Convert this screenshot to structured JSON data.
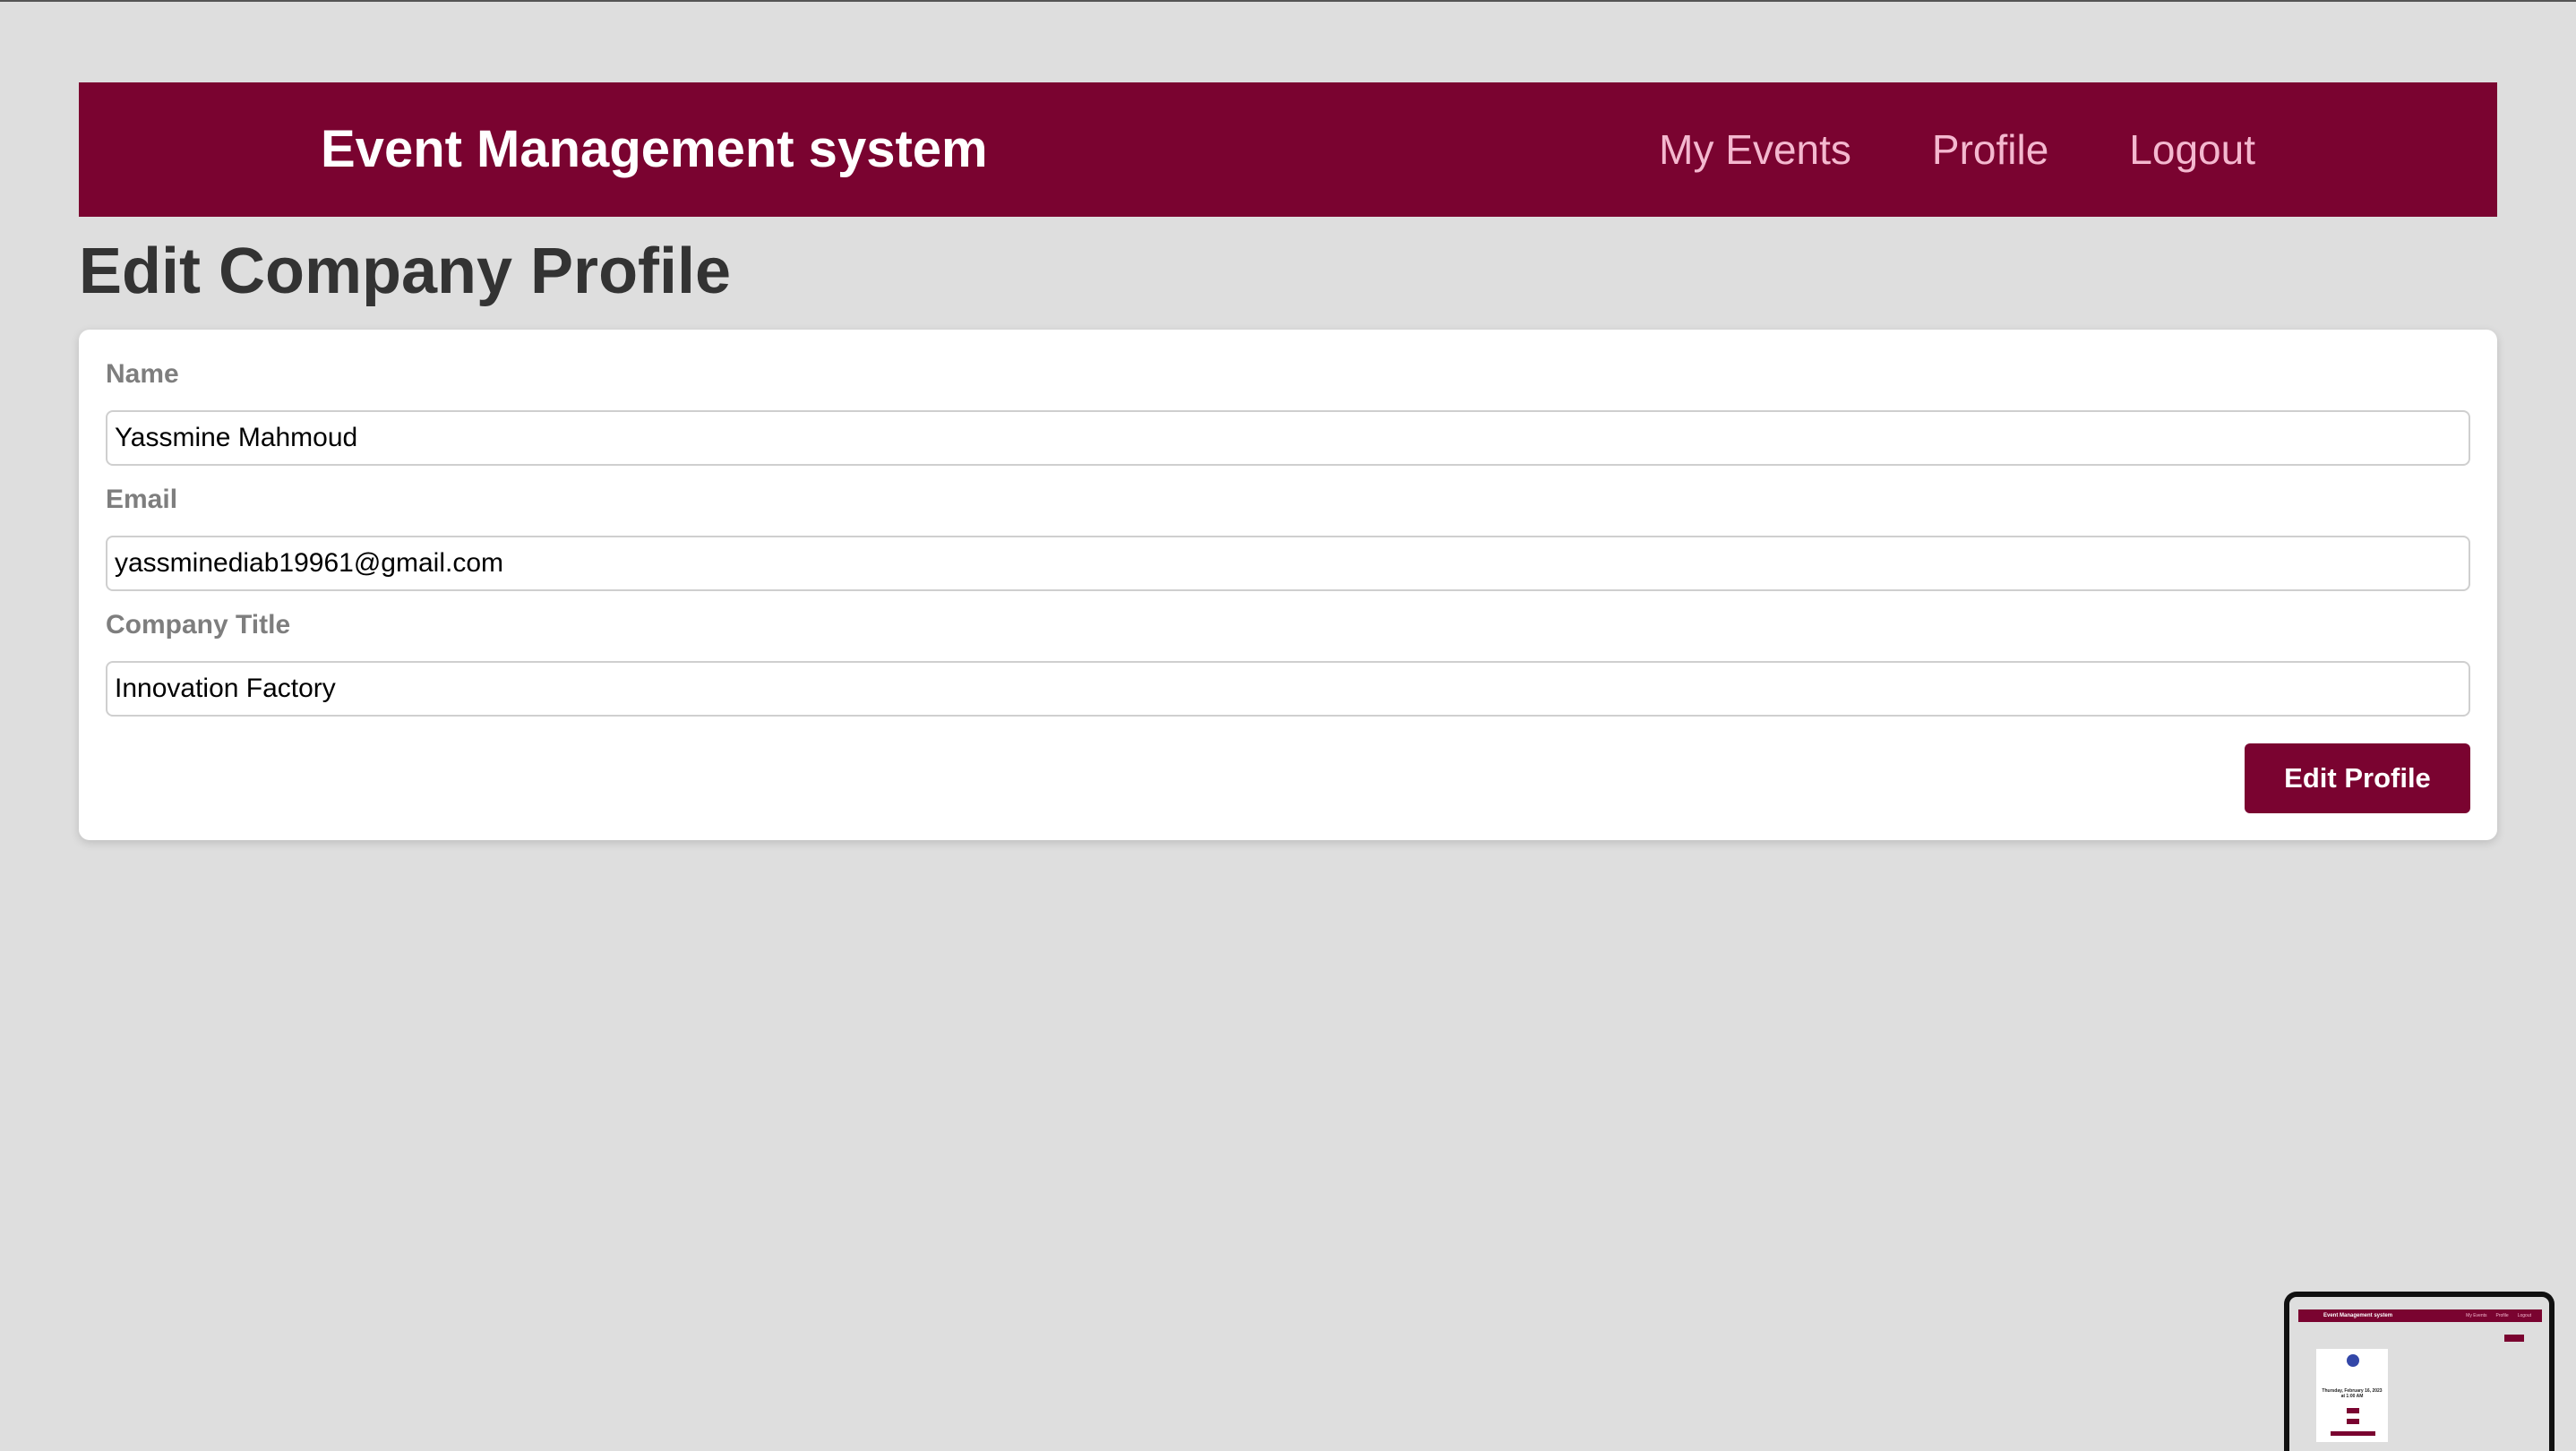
{
  "app": {
    "brand": "Event Management system"
  },
  "nav": {
    "links": [
      {
        "label": "My Events"
      },
      {
        "label": "Profile"
      },
      {
        "label": "Logout"
      }
    ]
  },
  "page": {
    "title": "Edit Company Profile"
  },
  "form": {
    "fields": [
      {
        "label": "Name",
        "value": "Yassmine Mahmoud"
      },
      {
        "label": "Email",
        "value": "yassminediab19961@gmail.com"
      },
      {
        "label": "Company Title",
        "value": "Innovation Factory"
      }
    ],
    "submit_label": "Edit Profile"
  },
  "colors": {
    "brand": "#7a0330",
    "background": "#dedede",
    "nav_link": "#f4b8cf",
    "card": "#ffffff"
  },
  "thumbnail": {
    "brand": "Event Management system",
    "links": [
      "My Events",
      "Profile",
      "Logout"
    ],
    "date_text": "Thursday, February 16, 2023 at 1:00 AM"
  }
}
